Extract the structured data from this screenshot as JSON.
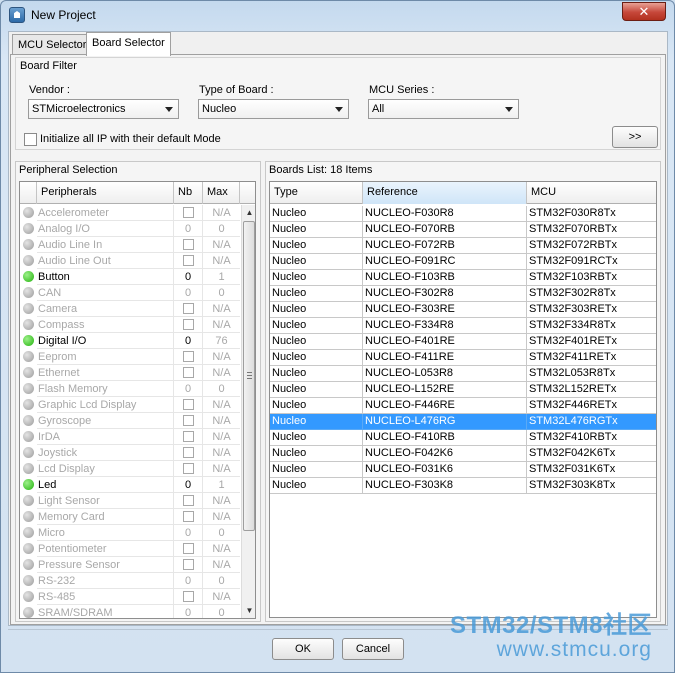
{
  "window": {
    "title": "New Project",
    "close_glyph": "✕"
  },
  "tabs": [
    {
      "label": "MCU Selector",
      "active": false
    },
    {
      "label": "Board Selector",
      "active": true
    }
  ],
  "board_filter": {
    "title": "Board Filter",
    "vendor_label": "Vendor :",
    "vendor_value": "STMicroelectronics",
    "type_label": "Type of Board :",
    "type_value": "Nucleo",
    "series_label": "MCU Series :",
    "series_value": "All",
    "init_ip_label": "Initialize all IP with their default Mode",
    "init_ip_checked": false,
    "expand_button": ">>"
  },
  "peripherals": {
    "title": "Peripheral Selection",
    "columns": [
      "Peripherals",
      "Nb",
      "Max"
    ],
    "rows": [
      {
        "name": "Accelerometer",
        "nb": "",
        "max": "N/A",
        "enabled": false
      },
      {
        "name": "Analog I/O",
        "nb": "0",
        "max": "0",
        "enabled": false
      },
      {
        "name": "Audio Line In",
        "nb": "",
        "max": "N/A",
        "enabled": false
      },
      {
        "name": "Audio Line Out",
        "nb": "",
        "max": "N/A",
        "enabled": false
      },
      {
        "name": "Button",
        "nb": "0",
        "max": "1",
        "enabled": true
      },
      {
        "name": "CAN",
        "nb": "0",
        "max": "0",
        "enabled": false
      },
      {
        "name": "Camera",
        "nb": "",
        "max": "N/A",
        "enabled": false
      },
      {
        "name": "Compass",
        "nb": "",
        "max": "N/A",
        "enabled": false
      },
      {
        "name": "Digital I/O",
        "nb": "0",
        "max": "76",
        "enabled": true
      },
      {
        "name": "Eeprom",
        "nb": "",
        "max": "N/A",
        "enabled": false
      },
      {
        "name": "Ethernet",
        "nb": "",
        "max": "N/A",
        "enabled": false
      },
      {
        "name": "Flash Memory",
        "nb": "0",
        "max": "0",
        "enabled": false
      },
      {
        "name": "Graphic Lcd Display",
        "nb": "",
        "max": "N/A",
        "enabled": false
      },
      {
        "name": "Gyroscope",
        "nb": "",
        "max": "N/A",
        "enabled": false
      },
      {
        "name": "IrDA",
        "nb": "",
        "max": "N/A",
        "enabled": false
      },
      {
        "name": "Joystick",
        "nb": "",
        "max": "N/A",
        "enabled": false
      },
      {
        "name": "Lcd Display",
        "nb": "",
        "max": "N/A",
        "enabled": false
      },
      {
        "name": "Led",
        "nb": "0",
        "max": "1",
        "enabled": true
      },
      {
        "name": "Light Sensor",
        "nb": "",
        "max": "N/A",
        "enabled": false
      },
      {
        "name": "Memory Card",
        "nb": "",
        "max": "N/A",
        "enabled": false
      },
      {
        "name": "Micro",
        "nb": "0",
        "max": "0",
        "enabled": false
      },
      {
        "name": "Potentiometer",
        "nb": "",
        "max": "N/A",
        "enabled": false
      },
      {
        "name": "Pressure Sensor",
        "nb": "",
        "max": "N/A",
        "enabled": false
      },
      {
        "name": "RS-232",
        "nb": "0",
        "max": "0",
        "enabled": false
      },
      {
        "name": "RS-485",
        "nb": "",
        "max": "N/A",
        "enabled": false
      },
      {
        "name": "SRAM/SDRAM",
        "nb": "0",
        "max": "0",
        "enabled": false
      }
    ]
  },
  "boards": {
    "title": "Boards List: 18 Items",
    "columns": [
      "Type",
      "Reference",
      "MCU"
    ],
    "selected_index": 13,
    "rows": [
      {
        "type": "Nucleo",
        "reference": "NUCLEO-F030R8",
        "mcu": "STM32F030R8Tx"
      },
      {
        "type": "Nucleo",
        "reference": "NUCLEO-F070RB",
        "mcu": "STM32F070RBTx"
      },
      {
        "type": "Nucleo",
        "reference": "NUCLEO-F072RB",
        "mcu": "STM32F072RBTx"
      },
      {
        "type": "Nucleo",
        "reference": "NUCLEO-F091RC",
        "mcu": "STM32F091RCTx"
      },
      {
        "type": "Nucleo",
        "reference": "NUCLEO-F103RB",
        "mcu": "STM32F103RBTx"
      },
      {
        "type": "Nucleo",
        "reference": "NUCLEO-F302R8",
        "mcu": "STM32F302R8Tx"
      },
      {
        "type": "Nucleo",
        "reference": "NUCLEO-F303RE",
        "mcu": "STM32F303RETx"
      },
      {
        "type": "Nucleo",
        "reference": "NUCLEO-F334R8",
        "mcu": "STM32F334R8Tx"
      },
      {
        "type": "Nucleo",
        "reference": "NUCLEO-F401RE",
        "mcu": "STM32F401RETx"
      },
      {
        "type": "Nucleo",
        "reference": "NUCLEO-F411RE",
        "mcu": "STM32F411RETx"
      },
      {
        "type": "Nucleo",
        "reference": "NUCLEO-L053R8",
        "mcu": "STM32L053R8Tx"
      },
      {
        "type": "Nucleo",
        "reference": "NUCLEO-L152RE",
        "mcu": "STM32L152RETx"
      },
      {
        "type": "Nucleo",
        "reference": "NUCLEO-F446RE",
        "mcu": "STM32F446RETx"
      },
      {
        "type": "Nucleo",
        "reference": "NUCLEO-L476RG",
        "mcu": "STM32L476RGTx"
      },
      {
        "type": "Nucleo",
        "reference": "NUCLEO-F410RB",
        "mcu": "STM32F410RBTx"
      },
      {
        "type": "Nucleo",
        "reference": "NUCLEO-F042K6",
        "mcu": "STM32F042K6Tx"
      },
      {
        "type": "Nucleo",
        "reference": "NUCLEO-F031K6",
        "mcu": "STM32F031K6Tx"
      },
      {
        "type": "Nucleo",
        "reference": "NUCLEO-F303K8",
        "mcu": "STM32F303K8Tx"
      }
    ]
  },
  "footer": {
    "ok_label": "OK",
    "cancel_label": "Cancel"
  },
  "watermark": {
    "line1": "STM32/STM8社区",
    "line2": "www.stmcu.org"
  },
  "colors": {
    "selection": "#3399ff",
    "led_on": "#22b30c",
    "led_off": "#9a9a9a",
    "close_button": "#c6473a"
  }
}
